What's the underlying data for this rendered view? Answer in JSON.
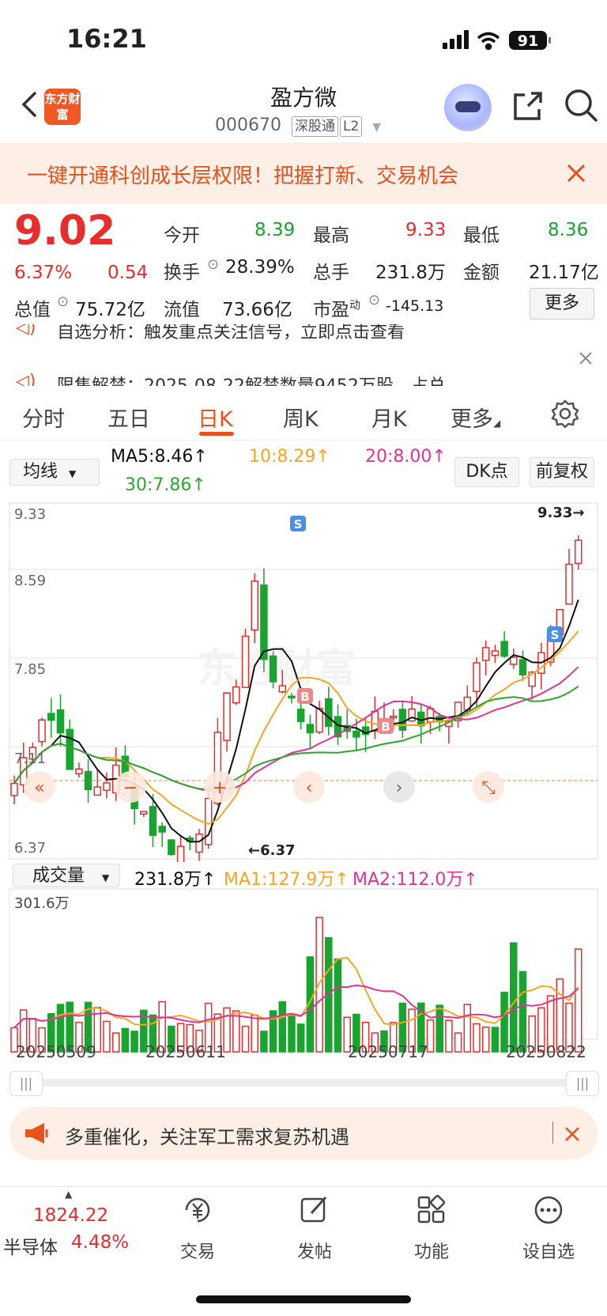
{
  "status": {
    "time": "16:21",
    "battery": "91"
  },
  "header": {
    "logo_text": "东方财富",
    "name": "盈方微",
    "code": "000670",
    "tag1": "深股通",
    "tag2": "L2"
  },
  "banner": {
    "text": "一键开通科创成长层权限！把握打新、交易机会"
  },
  "quote": {
    "price": "9.02",
    "change_pct": "6.37%",
    "change": "0.54",
    "open_label": "今开",
    "open": "8.39",
    "high_label": "最高",
    "high": "9.33",
    "low_label": "最低",
    "low": "8.36",
    "turnover_label": "换手",
    "turnover": "28.39%",
    "volume_label": "总手",
    "volume": "231.8万",
    "amount_label": "金额",
    "amount": "21.17亿",
    "mcap_label": "总值",
    "mcap": "75.72亿",
    "float_label": "流值",
    "float": "73.66亿",
    "pe_label": "市盈",
    "pe_sup": "动",
    "pe": "-145.13",
    "more": "更多"
  },
  "notices": [
    {
      "text": "自选分析：触发重点关注信号，立即点击查看"
    },
    {
      "text": "限售解禁：2025-08-22解禁数量9452万股，占总"
    }
  ],
  "tabs": [
    "分时",
    "五日",
    "日K",
    "周K",
    "月K",
    "更多"
  ],
  "active_tab": "日K",
  "indicators": {
    "selector": "均线",
    "ma5": "MA5:8.46↑",
    "ma10": "10:8.29↑",
    "ma20": "20:8.00↑",
    "ma30": "30:7.86↑",
    "dk_button": "DK点",
    "adjust_button": "前复权"
  },
  "kline": {
    "y_labels": [
      "9.33",
      "8.59",
      "7.85",
      "7.11",
      "6.37"
    ],
    "max_label": "9.33→",
    "min_label": "←6.37",
    "colors": {
      "up": "#e82d2d",
      "down": "#18a42e",
      "ma5": "#111111",
      "ma10": "#f5a623",
      "ma20": "#e0339a",
      "ma30": "#2fa52f"
    }
  },
  "volume": {
    "selector": "成交量",
    "value": "231.8万↑",
    "ma1": "MA1:127.9万↑",
    "ma2": "MA2:112.0万↑",
    "max_label": "301.6万",
    "dates": [
      "20250509",
      "20250611",
      "20250717",
      "20250822"
    ]
  },
  "chart_data": {
    "type": "candlestick",
    "ylim": [
      6.37,
      9.33
    ],
    "annotations": [
      "S",
      "B",
      "B",
      "S"
    ]
  },
  "promo": {
    "text": "多重催化，关注军工需求复苏机遇"
  },
  "bottom": {
    "index_value": "1824.22",
    "index_name": "半导体",
    "index_change": "4.48%",
    "items": [
      "交易",
      "发帖",
      "功能",
      "设自选"
    ]
  }
}
